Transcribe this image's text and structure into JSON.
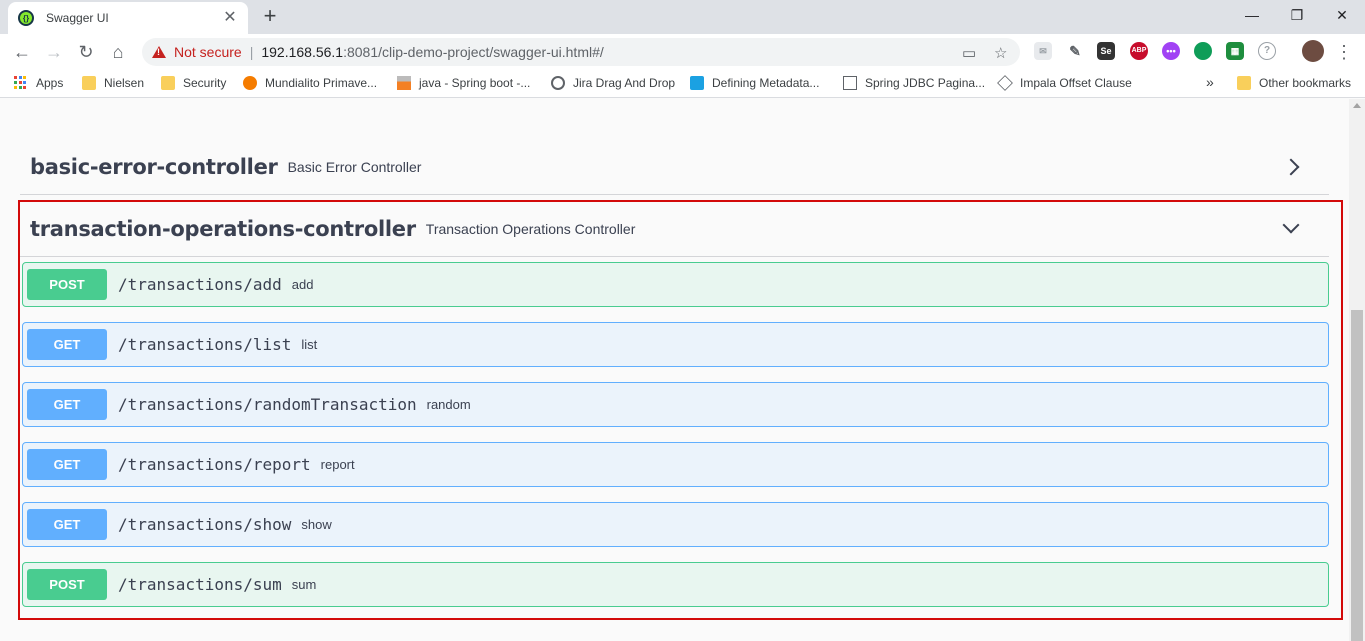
{
  "browser": {
    "tab_title": "Swagger UI",
    "tab_close": "✕",
    "new_tab": "+",
    "window_controls": [
      "—",
      "❐",
      "✕"
    ],
    "security_label": "Not secure",
    "url_host": "192.168.56.1",
    "url_rest": ":8081/clip-demo-project/swagger-ui.html#/"
  },
  "bookmarks": {
    "items": [
      "Apps",
      "Nielsen",
      "Security",
      "Mundialito Primave...",
      "java - Spring boot -...",
      "Jira Drag And Drop",
      "Defining Metadata...",
      "Spring JDBC Pagina...",
      "Impala Offset Clause"
    ],
    "overflow": "»",
    "other": "Other bookmarks"
  },
  "extensions": {
    "selenium": "Se",
    "adblock": "ABP"
  },
  "controllers": [
    {
      "name": "basic-error-controller",
      "description": "Basic Error Controller",
      "expanded": false
    },
    {
      "name": "transaction-operations-controller",
      "description": "Transaction Operations Controller",
      "expanded": true
    }
  ],
  "operations": [
    {
      "method": "POST",
      "path": "/transactions/add",
      "summary": "add"
    },
    {
      "method": "GET",
      "path": "/transactions/list",
      "summary": "list"
    },
    {
      "method": "GET",
      "path": "/transactions/randomTransaction",
      "summary": "random"
    },
    {
      "method": "GET",
      "path": "/transactions/report",
      "summary": "report"
    },
    {
      "method": "GET",
      "path": "/transactions/show",
      "summary": "show"
    },
    {
      "method": "POST",
      "path": "/transactions/sum",
      "summary": "sum"
    }
  ],
  "colors": {
    "post": "#49cc90",
    "get": "#61affe",
    "highlight": "#d30a0a"
  }
}
